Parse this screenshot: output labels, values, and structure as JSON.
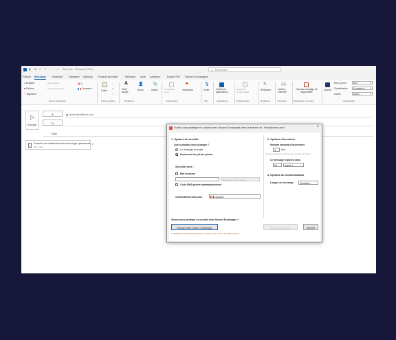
{
  "titlebar": {
    "title": "Sans titre - Message (HTML)",
    "search_placeholder": "Rechercher",
    "colors": {
      "outlook_blue": "#0f5ea8"
    }
  },
  "menu": {
    "tabs": [
      "Fichier",
      "Message",
      "Insertion",
      "Dessiner",
      "Options",
      "Format du texte",
      "Révision",
      "Aide",
      "Antidote",
      "Kofax PDF",
      "Secure Exchanges"
    ],
    "active": "Message"
  },
  "ribbon": {
    "secure_exchanges": {
      "enabled": "Enabled",
      "files": "Fichiers",
      "signature": "Signature",
      "pdf_sign": "PDF à signer",
      "sign_by_link": "Signature par lien",
      "language": "Français",
      "group": "Secure Exchanges"
    },
    "clipboard": {
      "paste": "Coller",
      "group": "Presse-papiers"
    },
    "text": {
      "simple_text": "Texte simple",
      "names": "Noms",
      "include": "Inclure",
      "group": "Rédaction"
    },
    "collaboration": {
      "loop": "Composant Loop",
      "indicators": "Indicateurs",
      "group": "Collaboration"
    },
    "voice": {
      "dictate": "Dicter",
      "group": "Voix"
    },
    "apps": {
      "all_apps": "Toutes les applications",
      "group": "Applications"
    },
    "confidentiality": {
      "label": "Niveau de confidentialité",
      "group": "Confidentialité"
    },
    "editor": {
      "label": "Rédacteur",
      "group": "Rédacteur"
    },
    "reader": {
      "label": "Lecteur immersif",
      "group": "Immersive"
    },
    "poll": {
      "label": "Nouveau sondage de disponibilité",
      "group": "Rechercher un horaire"
    },
    "avanza": {
      "label": "Avanza"
    },
    "classification": {
      "recu_label": "Reçu, périm.",
      "recu_value": "Non",
      "class_label": "Classification",
      "class_value": "À usage int...",
      "libelle_label": "Libellé",
      "libelle_value": "Aucun",
      "group": "Classification"
    }
  },
  "compose": {
    "send_label": "Envoyer",
    "to_label": "À",
    "cc_label": "Cc",
    "subject_label": "Objet",
    "to_value": "servicedient@vars.com",
    "attachment": {
      "name": "Protection des infrastructures de technologie opérationnelle (TO) (1).pptx (11,59 MB)",
      "size": "467 octets"
    }
  },
  "dialog": {
    "title": "Voulez-vous protéger ce courriel avec Secure Exchanges avec la licence de : !Nom@vars.com?",
    "security": {
      "heading": "1. Options de sécurité",
      "question": "Que souhaitez-vous protéger ?",
      "opt_message": "Le message en entier",
      "opt_attachments": "Seulement les pièces jointes",
      "secure_with": "Sécuriser avec :",
      "password": "Mot de passe",
      "generate_password": "Générer un mot de passe",
      "sms": "Code SMS généré automatiquement",
      "email": "servicedient@vars.com",
      "country": "Canada"
    },
    "opening": {
      "heading": "2. Options d'ouverture",
      "max_label": "Nombre maximal d'ouvertures",
      "max_value": "3",
      "max_unit": "fois",
      "max_note": "Ouverture associée seulement aux courriels non requis",
      "expire_label": "Le message expirera dans",
      "expire_value": "30",
      "expire_unit": "jour(s)"
    },
    "communication": {
      "heading": "3. Options de communication",
      "lang_label": "Langue du message",
      "lang_value": "Français"
    },
    "question": "Voulez-vous protéger ce courriel avec Secure Exchanges ?",
    "send_secure": "Envoyer avec Secure Exchanges",
    "send_unsecured": "Envoyer non sécurisé",
    "cancel": "Annuler",
    "warning": "L'utilisation de Secure Exchanges est requise pour envoyer les pièces jointes."
  }
}
